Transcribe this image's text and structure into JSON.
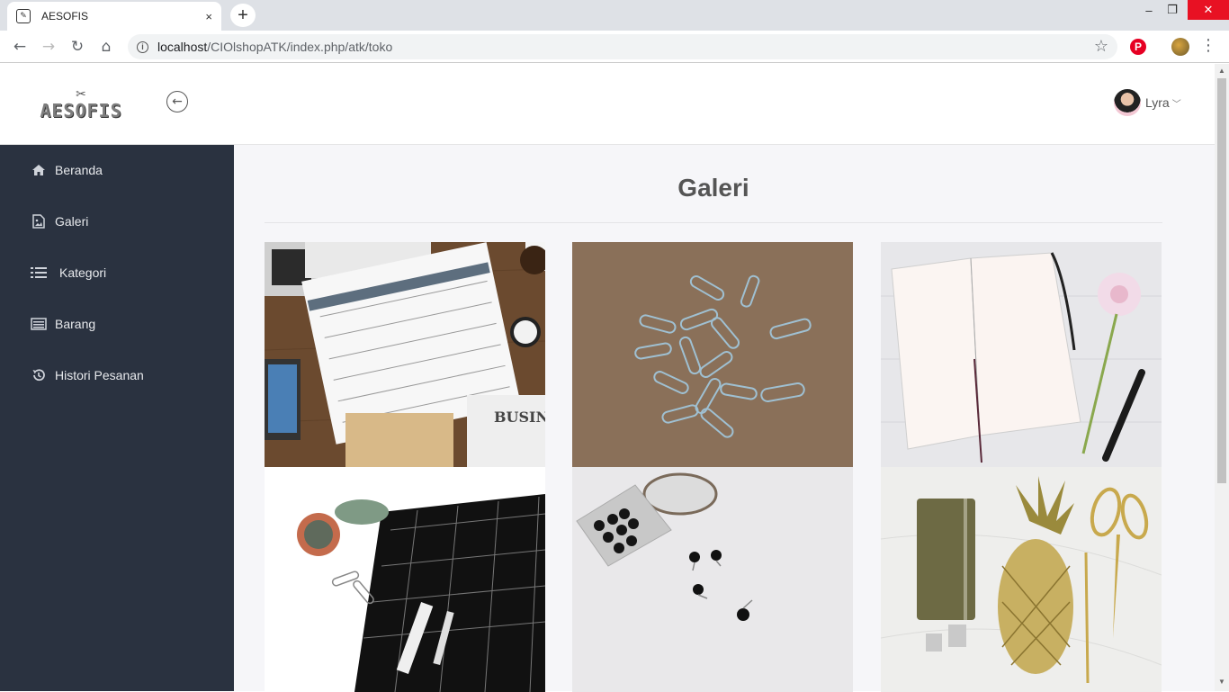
{
  "browser": {
    "tab_title": "AESOFIS",
    "tab_close": "×",
    "new_tab": "+",
    "url_host": "localhost",
    "url_path": "/CIOlshopATK/index.php/atk/toko",
    "window_controls": {
      "minimize": "–",
      "maximize": "❐",
      "close": "✕"
    }
  },
  "header": {
    "logo_text": "AESOFIS",
    "user_name": "Lyra"
  },
  "sidebar": {
    "items": [
      {
        "label": "Beranda",
        "icon": "home-icon"
      },
      {
        "label": "Galeri",
        "icon": "image-file-icon"
      },
      {
        "label": "Kategori",
        "icon": "list-icon"
      },
      {
        "label": "Barang",
        "icon": "box-list-icon"
      },
      {
        "label": "Histori Pesanan",
        "icon": "history-icon"
      }
    ]
  },
  "main": {
    "title": "Galeri",
    "gallery": [
      {
        "name": "calendar-desk-photo"
      },
      {
        "name": "paper-clips-photo"
      },
      {
        "name": "open-notebook-photo"
      },
      {
        "name": "black-calendar-planner-photo"
      },
      {
        "name": "push-pins-photo"
      },
      {
        "name": "gold-stationery-photo"
      }
    ]
  },
  "colors": {
    "sidebar_bg": "#2a3240",
    "content_bg": "#f6f6f9",
    "accent_close": "#e81123"
  }
}
